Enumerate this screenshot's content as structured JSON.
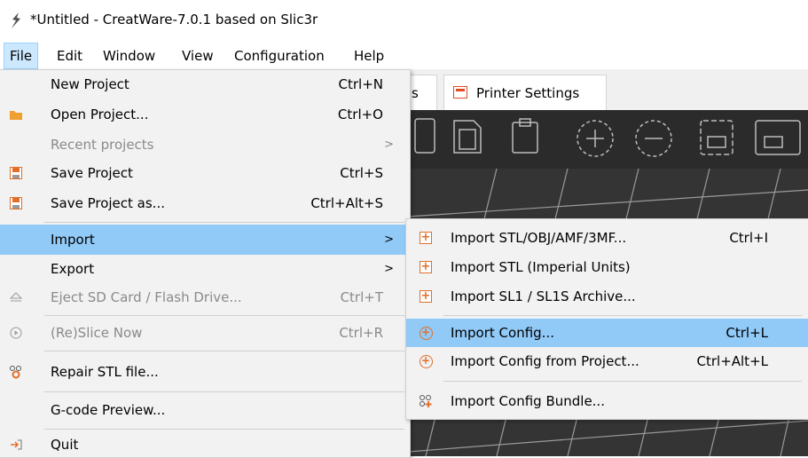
{
  "window": {
    "title": "*Untitled - CreatWare-7.0.1 based on Slic3r"
  },
  "menubar": {
    "items": [
      "File",
      "Edit",
      "Window",
      "View",
      "Configuration",
      "Help"
    ]
  },
  "tabs": {
    "partial_label": "s",
    "printer_settings": "Printer Settings"
  },
  "file_menu": {
    "items": [
      {
        "label": "New Project",
        "shortcut": "Ctrl+N",
        "icon": "none"
      },
      {
        "label": "Open Project...",
        "shortcut": "Ctrl+O",
        "icon": "folder-icon"
      },
      {
        "label": "Recent projects",
        "shortcut": "",
        "icon": "none",
        "submenu": true,
        "disabled": true
      },
      {
        "label": "Save Project",
        "shortcut": "Ctrl+S",
        "icon": "save-icon"
      },
      {
        "label": "Save Project as...",
        "shortcut": "Ctrl+Alt+S",
        "icon": "save-icon"
      },
      {
        "label": "Import",
        "shortcut": "",
        "icon": "none",
        "submenu": true,
        "highlighted": true
      },
      {
        "label": "Export",
        "shortcut": "",
        "icon": "none",
        "submenu": true
      },
      {
        "label": "Eject SD Card / Flash Drive...",
        "shortcut": "Ctrl+T",
        "icon": "eject-icon",
        "disabled": true
      },
      {
        "label": "(Re)Slice Now",
        "shortcut": "Ctrl+R",
        "icon": "play-icon",
        "disabled": true
      },
      {
        "label": "Repair STL file...",
        "shortcut": "",
        "icon": "repair-icon"
      },
      {
        "label": "G-code Preview...",
        "shortcut": "",
        "icon": "none"
      },
      {
        "label": "Quit",
        "shortcut": "",
        "icon": "quit-icon"
      }
    ],
    "arrow": ">"
  },
  "import_menu": {
    "items": [
      {
        "label": "Import STL/OBJ/AMF/3MF...",
        "shortcut": "Ctrl+I",
        "icon": "import-plus-icon"
      },
      {
        "label": "Import STL (Imperial Units)",
        "shortcut": "",
        "icon": "import-plus-icon"
      },
      {
        "label": "Import SL1 / SL1S Archive...",
        "shortcut": "",
        "icon": "import-plus-icon"
      },
      {
        "label": "Import Config...",
        "shortcut": "Ctrl+L",
        "icon": "import-config-icon",
        "highlighted": true
      },
      {
        "label": "Import Config from Project...",
        "shortcut": "Ctrl+Alt+L",
        "icon": "import-config-icon"
      },
      {
        "label": "Import Config Bundle...",
        "shortcut": "",
        "icon": "config-bundle-icon"
      }
    ]
  },
  "colors": {
    "highlight": "#91c9f7",
    "menubar_active": "#cce8ff",
    "accent": "#e0702a",
    "canvas": "#343434"
  }
}
